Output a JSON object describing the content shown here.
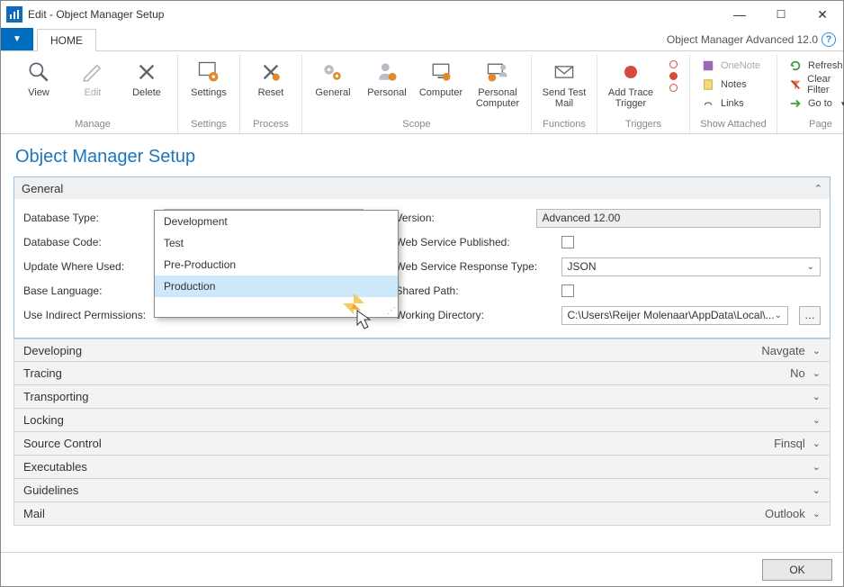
{
  "window": {
    "title": "Edit - Object Manager Setup",
    "brand": "Object Manager Advanced 12.0"
  },
  "tabs": {
    "home": "HOME"
  },
  "ribbon": {
    "manage": {
      "label": "Manage",
      "view": "View",
      "edit": "Edit",
      "delete": "Delete"
    },
    "settings": {
      "label": "Settings",
      "settings": "Settings"
    },
    "process": {
      "label": "Process",
      "reset": "Reset"
    },
    "scope": {
      "label": "Scope",
      "general": "General",
      "personal": "Personal",
      "computer": "Computer",
      "personal_computer": "Personal\nComputer"
    },
    "functions": {
      "label": "Functions",
      "send_test_mail": "Send Test Mail"
    },
    "triggers": {
      "label": "Triggers",
      "add_trace_trigger": "Add Trace Trigger"
    },
    "attached": {
      "label": "Show Attached",
      "onenote": "OneNote",
      "notes": "Notes",
      "links": "Links"
    },
    "page": {
      "label": "Page",
      "refresh": "Refresh",
      "clear_filter": "Clear Filter",
      "go_to": "Go to"
    }
  },
  "page": {
    "title": "Object Manager Setup"
  },
  "panel": {
    "title": "General"
  },
  "fields": {
    "left": {
      "database_type": {
        "label": "Database Type:",
        "value": "Production"
      },
      "database_code": {
        "label": "Database Code:"
      },
      "update_where_used": {
        "label": "Update Where Used:"
      },
      "base_language": {
        "label": "Base Language:"
      },
      "use_indirect_permissions": {
        "label": "Use Indirect Permissions:"
      }
    },
    "right": {
      "version": {
        "label": "Version:",
        "value": "Advanced 12.00"
      },
      "web_service_published": {
        "label": "Web Service Published:"
      },
      "web_service_response_type": {
        "label": "Web Service Response Type:",
        "value": "JSON"
      },
      "shared_path": {
        "label": "Shared Path:"
      },
      "working_directory": {
        "label": "Working Directory:",
        "value": "C:\\Users\\Reijer Molenaar\\AppData\\Local\\..."
      }
    }
  },
  "dropdown_options": [
    "Development",
    "Test",
    "Pre-Production",
    "Production"
  ],
  "accordion": [
    {
      "title": "Developing",
      "value": "Navgate"
    },
    {
      "title": "Tracing",
      "value": "No"
    },
    {
      "title": "Transporting",
      "value": ""
    },
    {
      "title": "Locking",
      "value": ""
    },
    {
      "title": "Source Control",
      "value": "Finsql"
    },
    {
      "title": "Executables",
      "value": ""
    },
    {
      "title": "Guidelines",
      "value": ""
    },
    {
      "title": "Mail",
      "value": "Outlook"
    }
  ],
  "footer": {
    "ok": "OK"
  }
}
